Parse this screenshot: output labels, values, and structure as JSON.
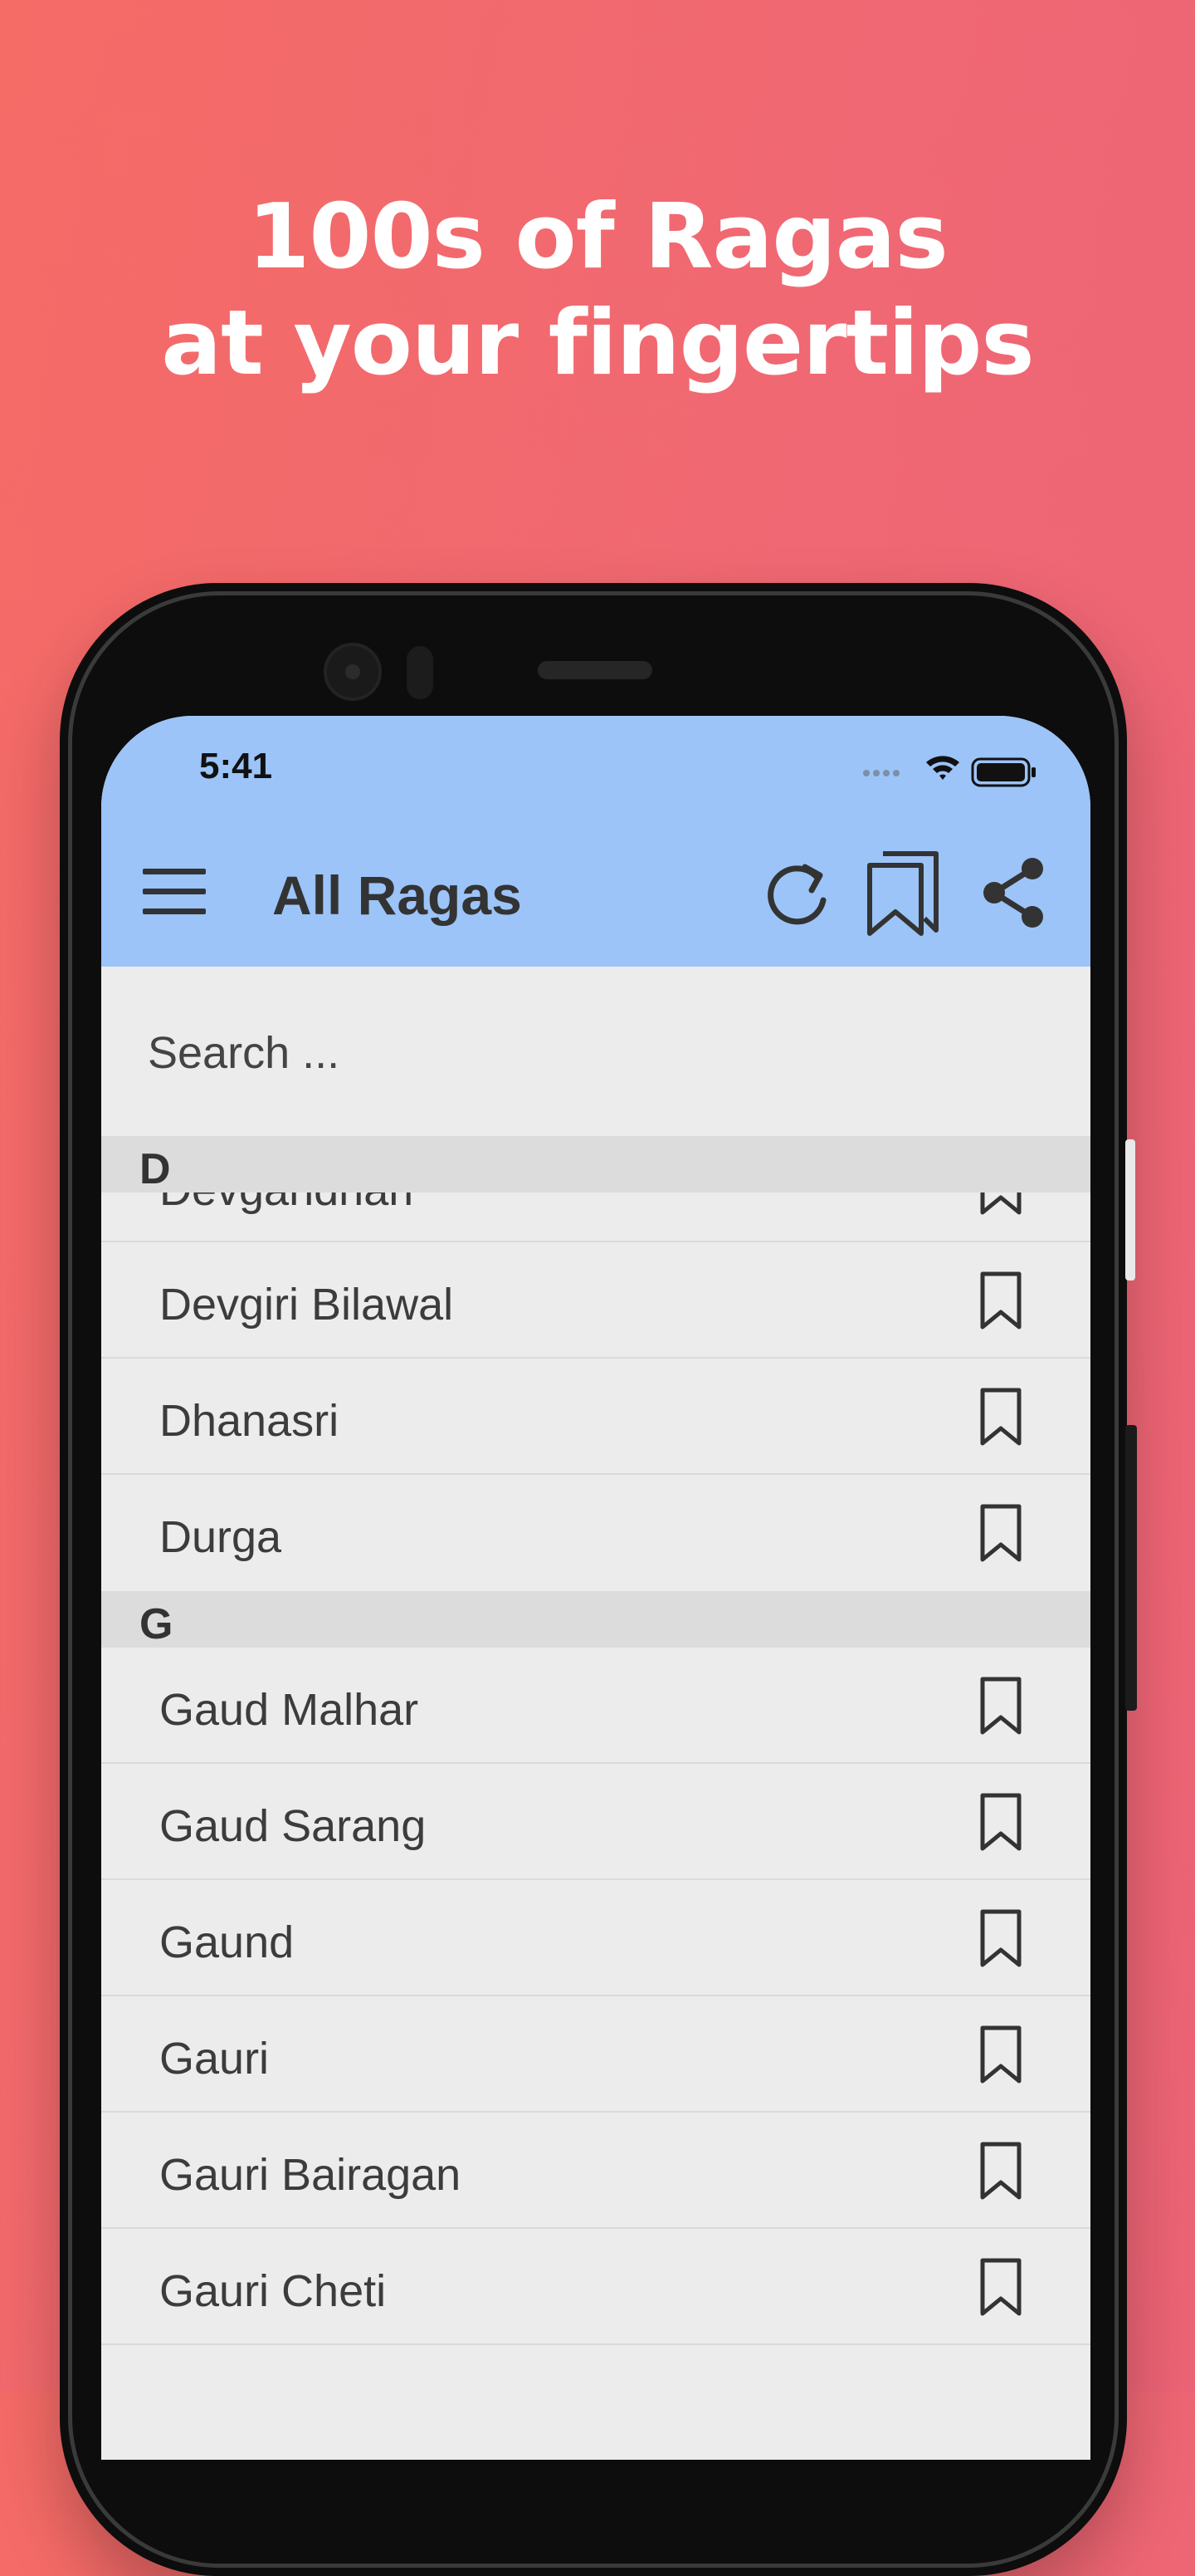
{
  "headline": {
    "line1": "100s of Ragas",
    "line2": "at your fingertips"
  },
  "status_bar": {
    "time": "5:41"
  },
  "app_bar": {
    "title": "All Ragas",
    "icons": [
      "menu-icon",
      "refresh-icon",
      "bookmarks-icon",
      "share-icon"
    ]
  },
  "search": {
    "placeholder": "Search ..."
  },
  "sections": [
    {
      "letter": "D",
      "items": [
        "Devgandhari",
        "Devgiri Bilawal",
        "Dhanasri",
        "Durga"
      ]
    },
    {
      "letter": "G",
      "items": [
        "Gaud Malhar",
        "Gaud Sarang",
        "Gaund",
        "Gauri",
        "Gauri Bairagan",
        "Gauri Cheti"
      ]
    }
  ],
  "colors": {
    "background_start": "#f56b66",
    "background_end": "#ec6375",
    "app_bar": "#9cc4f8",
    "list_background": "#ececec",
    "section_header": "#dcdcdc"
  }
}
